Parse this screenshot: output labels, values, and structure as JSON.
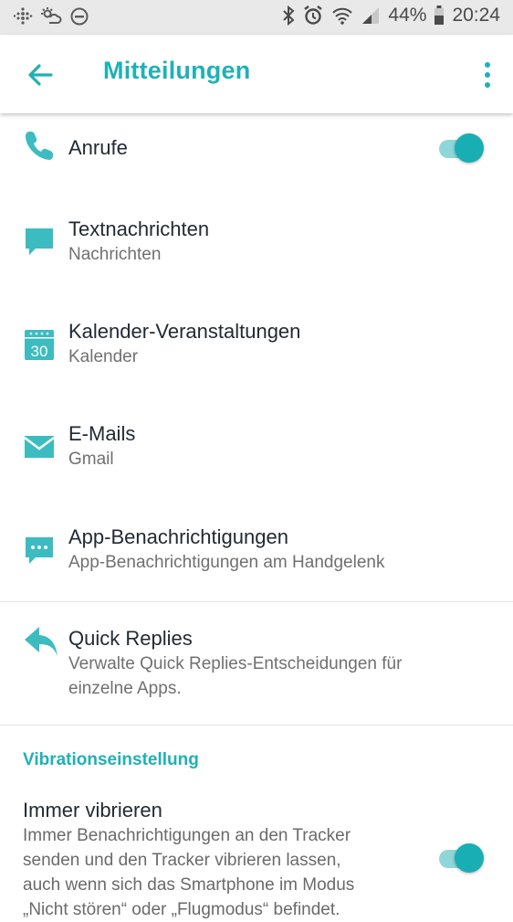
{
  "status_bar": {
    "battery_percent": "44%",
    "time": "20:24",
    "icons": [
      "fitbit-icon",
      "weather-icon",
      "do-not-disturb-icon",
      "bluetooth-icon",
      "alarm-icon",
      "wifi-icon",
      "signal-icon",
      "battery-icon"
    ]
  },
  "app_bar": {
    "title": "Mitteilungen",
    "back_icon": "arrow-back-icon",
    "menu_icon": "more-vert-icon"
  },
  "items": [
    {
      "icon": "phone-icon",
      "title": "Anrufe",
      "subtitle": "",
      "toggle": true
    },
    {
      "icon": "message-icon",
      "title": "Textnachrichten",
      "subtitle": "Nachrichten"
    },
    {
      "icon": "calendar-icon",
      "calendar_day": "30",
      "title": "Kalender-Veranstaltungen",
      "subtitle": "Kalender"
    },
    {
      "icon": "mail-icon",
      "title": "E-Mails",
      "subtitle": "Gmail"
    },
    {
      "icon": "app-notification-icon",
      "title": "App-Benachrichtigungen",
      "subtitle": "App-Benachrichtigungen am Handgelenk"
    }
  ],
  "quick_replies": {
    "icon": "reply-icon",
    "title": "Quick Replies",
    "subtitle_line1": "Verwalte Quick Replies-Entscheidungen für",
    "subtitle_line2": "einzelne Apps."
  },
  "vibration": {
    "section_title": "Vibrationseinstellung",
    "title": "Immer vibrieren",
    "desc_line1": "Immer Benachrichtigungen an den Tracker",
    "desc_line2": "senden und den Tracker vibrieren lassen,",
    "desc_line3": "auch wenn sich das Smartphone im Modus",
    "desc_line4": "„Nicht stören“ oder „Flugmodus“ befindet.",
    "toggle": true
  },
  "colors": {
    "accent": "#1fb1b6",
    "toggle_thumb": "#19aeb3",
    "toggle_track": "#8fd6d8",
    "icon": "#3cbcc0"
  }
}
